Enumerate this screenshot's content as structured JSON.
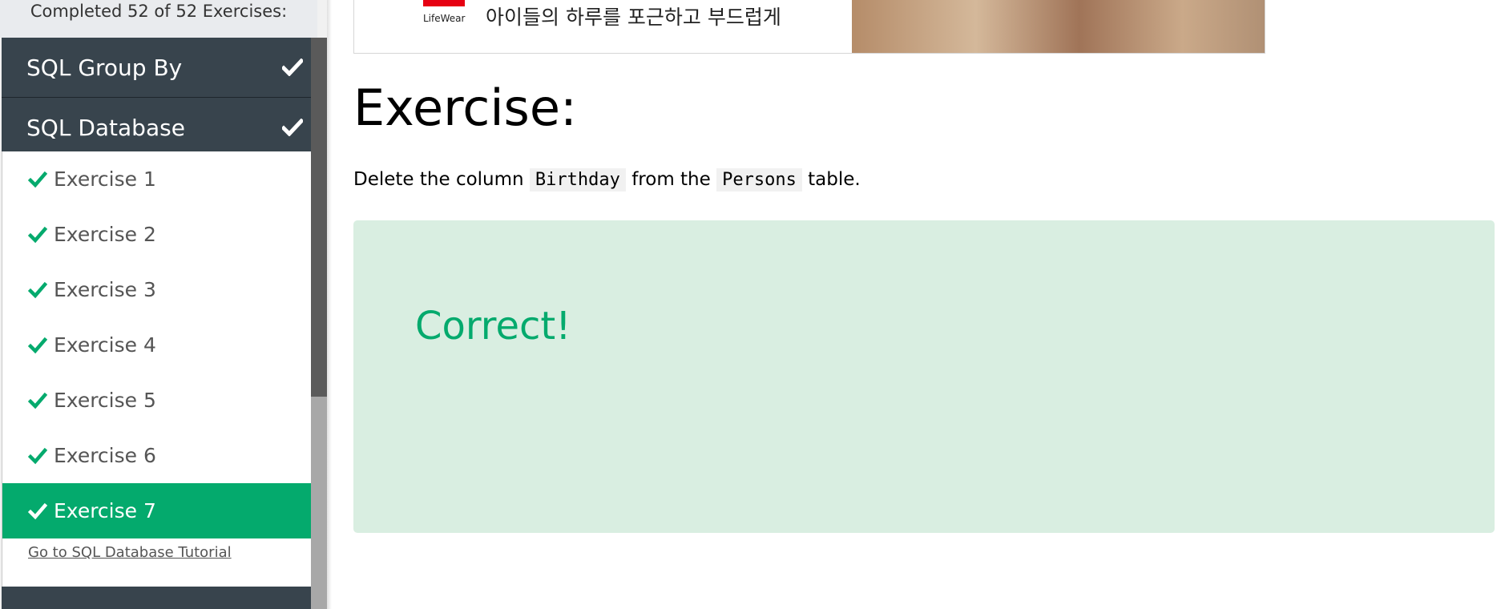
{
  "sidebar": {
    "status": "Completed 52 of 52 Exercises:",
    "groups": [
      {
        "label": "SQL Group By",
        "completed": true
      },
      {
        "label": "SQL Database",
        "completed": true
      }
    ],
    "exercises": [
      {
        "label": "Exercise 1",
        "completed": true
      },
      {
        "label": "Exercise 2",
        "completed": true
      },
      {
        "label": "Exercise 3",
        "completed": true
      },
      {
        "label": "Exercise 4",
        "completed": true
      },
      {
        "label": "Exercise 5",
        "completed": true
      },
      {
        "label": "Exercise 6",
        "completed": true
      },
      {
        "label": "Exercise 7",
        "completed": true,
        "active": true
      }
    ],
    "tutorial_link": "Go to SQL Database Tutorial"
  },
  "ad": {
    "brand_text": "LifeWear",
    "text": "아이들의 하루를 포근하고 부드럽게"
  },
  "main": {
    "title": "Exercise:",
    "instruction": {
      "part1": "Delete the column",
      "code1": "Birthday",
      "part2": "from the",
      "code2": "Persons",
      "part3": "table."
    },
    "result": "Correct!"
  },
  "colors": {
    "accent": "#04aa6d",
    "sidebar_dark": "#38444d",
    "result_bg": "#d9eee1"
  },
  "icons": {
    "check": "check-icon"
  }
}
